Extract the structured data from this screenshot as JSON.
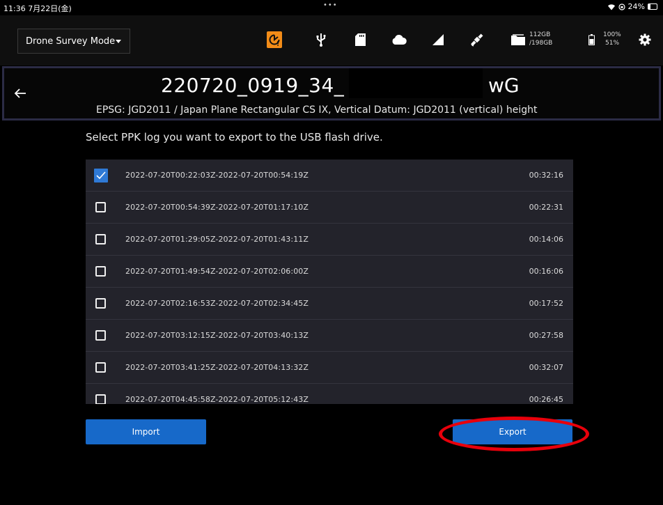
{
  "status_bar": {
    "time": "11:36 7月22日(金)",
    "battery_text": "24%",
    "battery_level": 0.24
  },
  "topbar": {
    "mode_label": "Drone Survey Mode",
    "icons": [
      "warning-icon",
      "usb-icon",
      "sd-card-icon",
      "cloud-icon",
      "signal-icon",
      "satellite-icon",
      "storage-icon",
      "battery-icon",
      "gear-icon"
    ],
    "storage_used": "112GB",
    "storage_total": "/198GB",
    "battery_1": "100%",
    "battery_2": "51%",
    "warning_color": "#f28c18"
  },
  "header": {
    "title_prefix": "220720_0919_34_",
    "title_suffix": "wG",
    "subtitle": "EPSG: JGD2011 / Japan Plane Rectangular CS IX, Vertical Datum: JGD2011 (vertical) height"
  },
  "instruction": "Select PPK log you want to export to the USB flash drive.",
  "logs": [
    {
      "name": "2022-07-20T00:22:03Z-2022-07-20T00:54:19Z",
      "duration": "00:32:16",
      "checked": true
    },
    {
      "name": "2022-07-20T00:54:39Z-2022-07-20T01:17:10Z",
      "duration": "00:22:31",
      "checked": false
    },
    {
      "name": "2022-07-20T01:29:05Z-2022-07-20T01:43:11Z",
      "duration": "00:14:06",
      "checked": false
    },
    {
      "name": "2022-07-20T01:49:54Z-2022-07-20T02:06:00Z",
      "duration": "00:16:06",
      "checked": false
    },
    {
      "name": "2022-07-20T02:16:53Z-2022-07-20T02:34:45Z",
      "duration": "00:17:52",
      "checked": false
    },
    {
      "name": "2022-07-20T03:12:15Z-2022-07-20T03:40:13Z",
      "duration": "00:27:58",
      "checked": false
    },
    {
      "name": "2022-07-20T03:41:25Z-2022-07-20T04:13:32Z",
      "duration": "00:32:07",
      "checked": false
    },
    {
      "name": "2022-07-20T04:45:58Z-2022-07-20T05:12:43Z",
      "duration": "00:26:45",
      "checked": false
    }
  ],
  "buttons": {
    "import_label": "Import",
    "export_label": "Export",
    "button_color": "#1769c9",
    "highlight_color": "#e8000b"
  }
}
